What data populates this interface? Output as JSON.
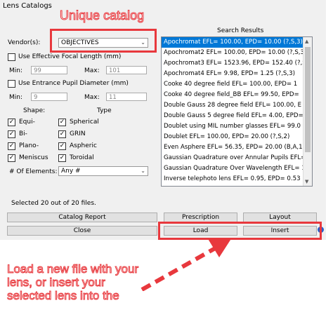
{
  "window": {
    "title": "Lens Catalogs"
  },
  "vendor": {
    "label": "Vendor(s):",
    "value": "OBJECTIVES"
  },
  "use_effective": {
    "label": "Use Effective Focal Length (mm)",
    "checked": false
  },
  "efl_min": {
    "label": "Min:",
    "value": "99"
  },
  "efl_max": {
    "label": "Max:",
    "value": "101"
  },
  "use_epd": {
    "label": "Use Entrance Pupil Diameter (mm)",
    "checked": false
  },
  "epd_min": {
    "label": "Min:",
    "value": "9"
  },
  "epd_max": {
    "label": "Max:",
    "value": "11"
  },
  "shape": {
    "header": "Shape:",
    "items": [
      {
        "label": "Equi-",
        "checked": true
      },
      {
        "label": "Bi-",
        "checked": true
      },
      {
        "label": "Plano-",
        "checked": true
      },
      {
        "label": "Meniscus",
        "checked": true
      }
    ]
  },
  "type": {
    "header": "Type",
    "items": [
      {
        "label": "Spherical",
        "checked": true
      },
      {
        "label": "GRIN",
        "checked": true
      },
      {
        "label": "Aspheric",
        "checked": true
      },
      {
        "label": "Toroidal",
        "checked": true
      }
    ]
  },
  "elements": {
    "label": "# Of Elements:",
    "value": "Any #"
  },
  "results": {
    "header": "Search Results",
    "items": [
      "Apochromat EFL= 100.00, EPD= 10.00 (?,S,3)",
      "Apochromat2 EFL= 100.00, EPD= 10.00 (?,S,3)",
      "Apochromat3 EFL= 1523.96, EPD= 152.40 (?,S,3)",
      "Apochromat4 EFL= 9.98, EPD= 1.25 (?,S,3)",
      "Cooke 40 degree field EFL= 100.00, EPD= 1",
      "Cooke 40 degree field_BB EFL= 99.50, EPD=",
      "Double Gauss 28 degree field EFL= 100.00, E",
      "Double Gauss 5 degree field EFL= 4.00, EPD=",
      "Doublet using MIL number glasses EFL= 99.0",
      "Doublet EFL= 100.00, EPD= 20.00 (?,S,2)",
      "Even Asphere EFL= 56.35, EPD= 20.00 (B,A,1)",
      "Gaussian Quadrature over Annular Pupils EFL= 1752",
      "Gaussian Quadrature Over Wavelength EFL= 133.32",
      "Inverse telephoto lens EFL= 0.95, EPD= 0.53 (?,S,6"
    ],
    "selected_index": 0
  },
  "status": "Selected 20 out of 20 files.",
  "buttons": {
    "catalog_report": "Catalog Report",
    "prescription": "Prescription",
    "layout": "Layout",
    "close": "Close",
    "load": "Load",
    "insert": "Insert"
  },
  "annotations": {
    "unique_catalog": "Unique catalog",
    "load_note": "Load a new file with your lens, or insert your selected lens into the",
    "load_note_lines": [
      "Load a new file with your",
      "lens, or insert your",
      "selected lens into the"
    ],
    "accent_color": "#e8383d"
  }
}
